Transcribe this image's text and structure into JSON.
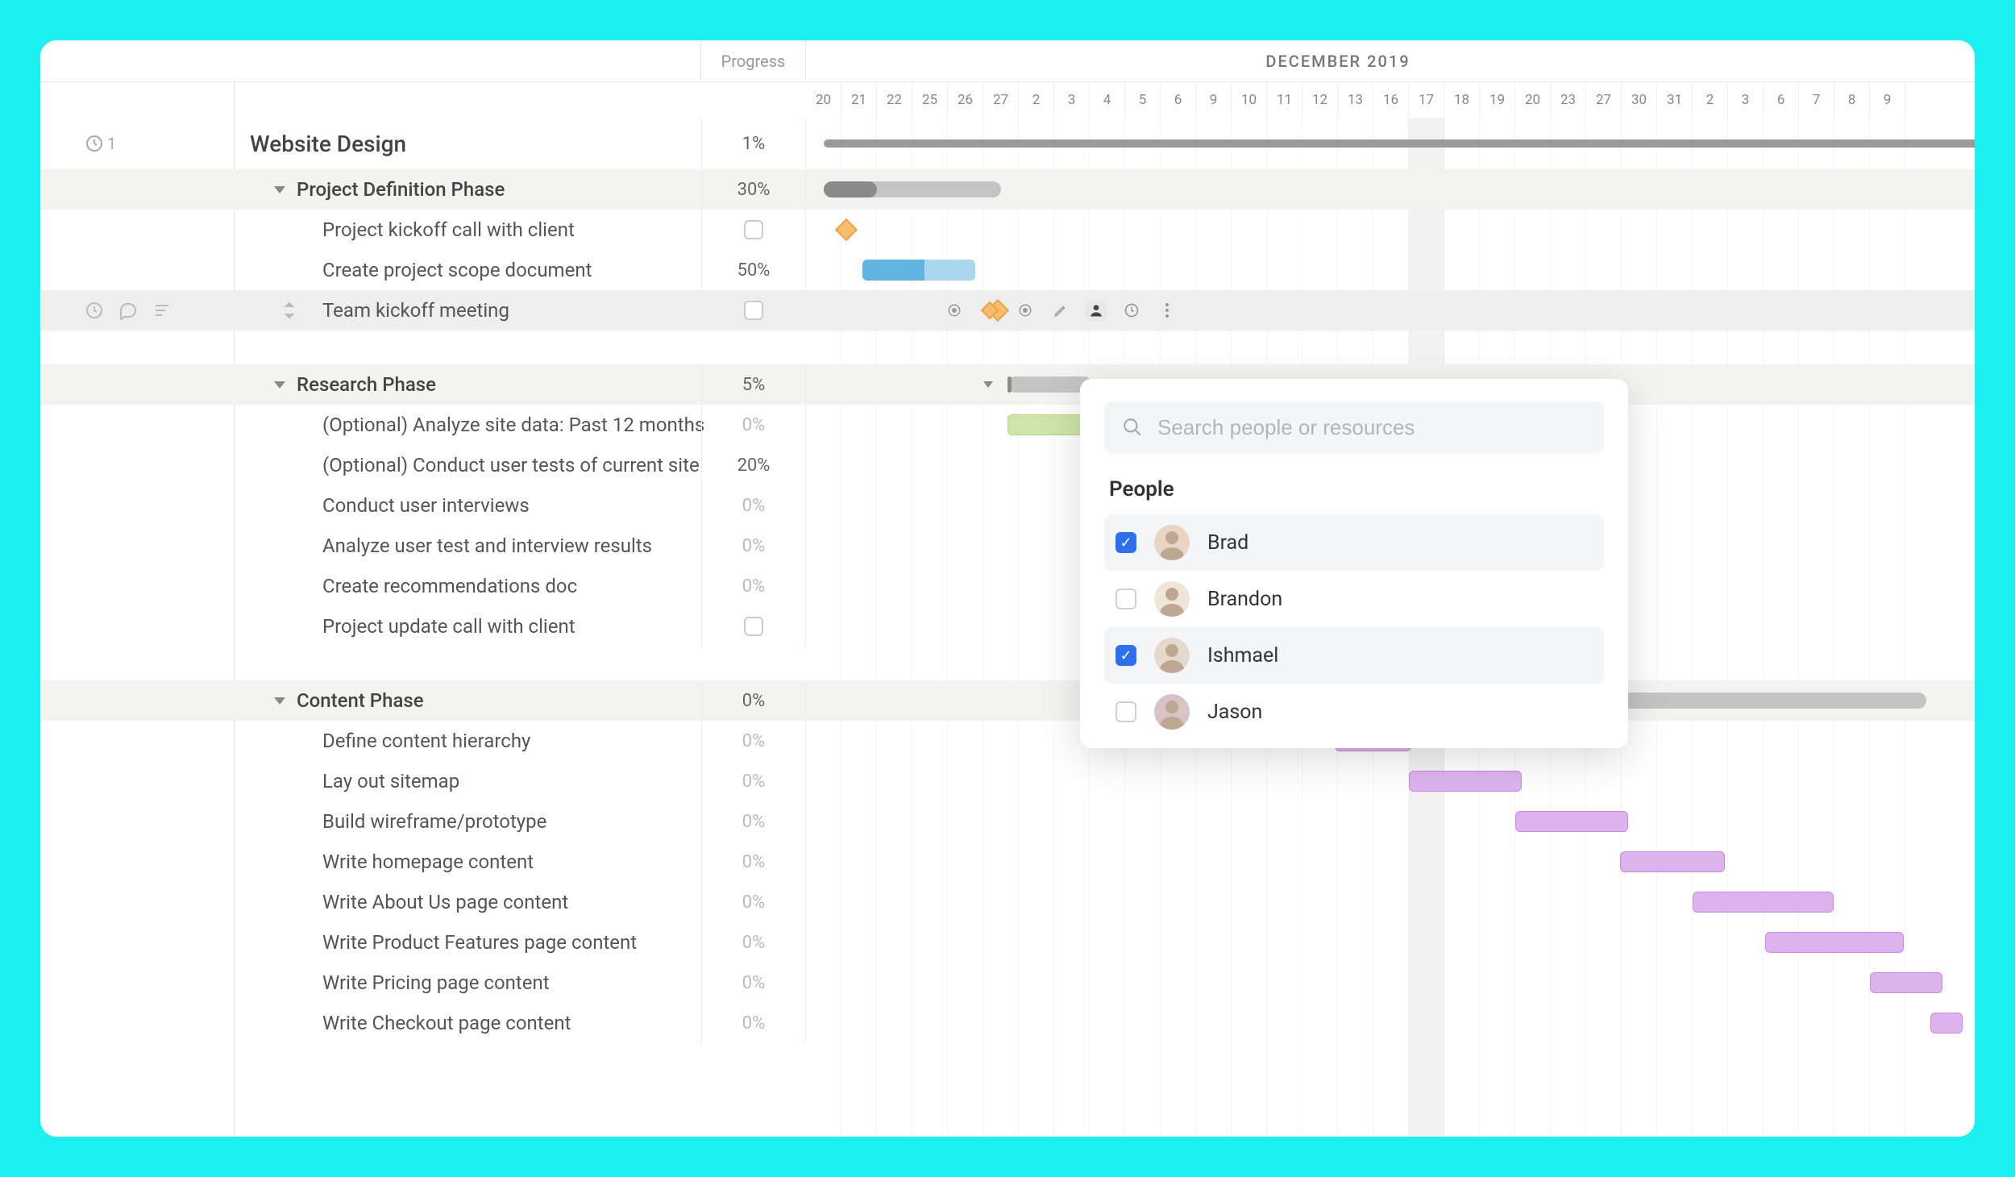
{
  "timeline": {
    "month_label": "DECEMBER 2019",
    "progress_header": "Progress",
    "days": [
      "20",
      "21",
      "22",
      "25",
      "26",
      "27",
      "2",
      "3",
      "4",
      "5",
      "6",
      "9",
      "10",
      "11",
      "12",
      "13",
      "16",
      "17",
      "18",
      "19",
      "20",
      "23",
      "27",
      "30",
      "31",
      "2",
      "3",
      "6",
      "7",
      "8",
      "9"
    ],
    "today_index": 17
  },
  "project": {
    "name": "Website Design",
    "progress": "1%",
    "attachment_count": "1"
  },
  "rows": [
    {
      "type": "group",
      "name": "Project Definition Phase",
      "progress": "30%"
    },
    {
      "type": "task",
      "name": "Project kickoff call with client",
      "checkbox": true
    },
    {
      "type": "task",
      "name": "Create project scope document",
      "progress": "50%"
    },
    {
      "type": "task",
      "name": "Team kickoff meeting",
      "checkbox": true,
      "selected": true
    },
    {
      "type": "spacer"
    },
    {
      "type": "group",
      "name": "Research Phase",
      "progress": "5%"
    },
    {
      "type": "task",
      "name": "(Optional) Analyze site data: Past 12 months",
      "progress": "0%",
      "dim": true
    },
    {
      "type": "task",
      "name": "(Optional) Conduct user tests of current site",
      "progress": "20%"
    },
    {
      "type": "task",
      "name": "Conduct user interviews",
      "progress": "0%",
      "dim": true
    },
    {
      "type": "task",
      "name": "Analyze user test and interview results",
      "progress": "0%",
      "dim": true
    },
    {
      "type": "task",
      "name": "Create recommendations doc",
      "progress": "0%",
      "dim": true
    },
    {
      "type": "task",
      "name": "Project update call with client",
      "checkbox": true
    },
    {
      "type": "spacer"
    },
    {
      "type": "group",
      "name": "Content Phase",
      "progress": "0%"
    },
    {
      "type": "task",
      "name": "Define content hierarchy",
      "progress": "0%",
      "dim": true
    },
    {
      "type": "task",
      "name": "Lay out sitemap",
      "progress": "0%",
      "dim": true
    },
    {
      "type": "task",
      "name": "Build wireframe/prototype",
      "progress": "0%",
      "dim": true
    },
    {
      "type": "task",
      "name": "Write homepage content",
      "progress": "0%",
      "dim": true
    },
    {
      "type": "task",
      "name": "Write About Us page content",
      "progress": "0%",
      "dim": true
    },
    {
      "type": "task",
      "name": "Write Product Features page content",
      "progress": "0%",
      "dim": true
    },
    {
      "type": "task",
      "name": "Write Pricing page content",
      "progress": "0%",
      "dim": true
    },
    {
      "type": "task",
      "name": "Write Checkout page content",
      "progress": "0%",
      "dim": true
    }
  ],
  "popup": {
    "search_placeholder": "Search people or resources",
    "section_title": "People",
    "people": [
      {
        "name": "Brad",
        "checked": true,
        "avatar_bg": "#e8d5c4"
      },
      {
        "name": "Brandon",
        "checked": false,
        "avatar_bg": "#f0e6d8"
      },
      {
        "name": "Ishmael",
        "checked": true,
        "avatar_bg": "#e4d9cc"
      },
      {
        "name": "Jason",
        "checked": false,
        "avatar_bg": "#d8c4c4"
      }
    ]
  },
  "toolbar_icons": [
    "circle-dot",
    "milestone",
    "circle-dot",
    "pencil",
    "person",
    "clock",
    "more"
  ]
}
